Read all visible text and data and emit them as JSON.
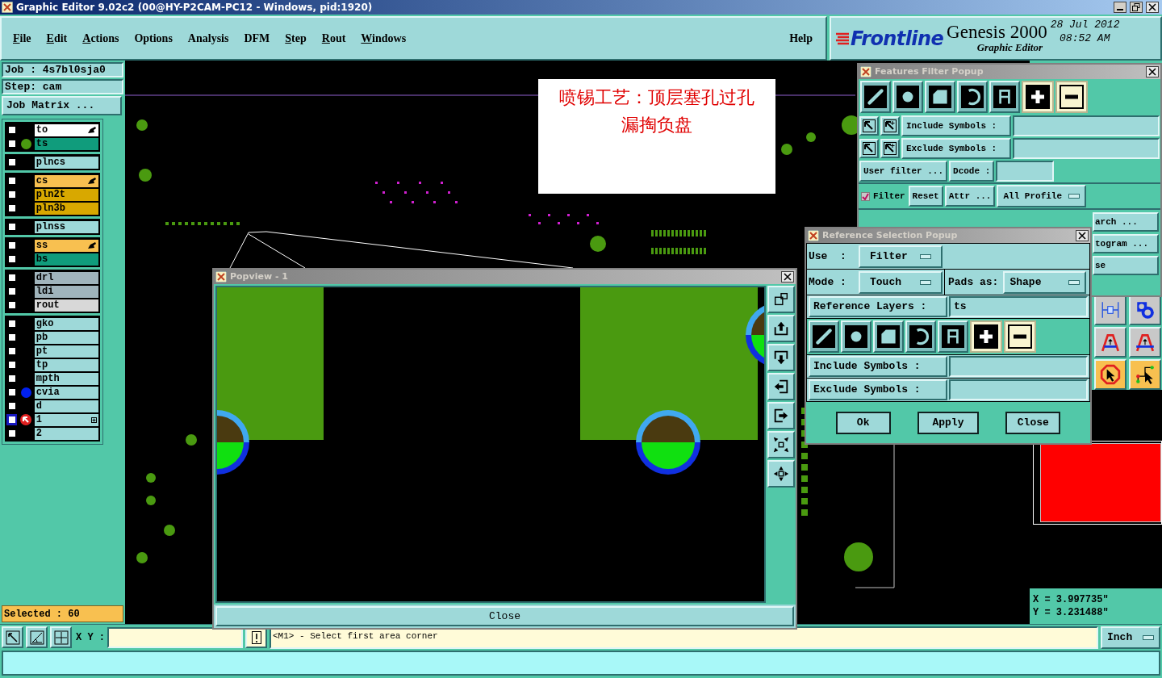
{
  "window": {
    "title": "Graphic Editor 9.02c2 (00@HY-P2CAM-PC12 - Windows, pid:1920)"
  },
  "menu": [
    {
      "label": "File",
      "mnemonic": true
    },
    {
      "label": "Edit",
      "mnemonic": true
    },
    {
      "label": "Actions",
      "mnemonic": true
    },
    {
      "label": "Options",
      "mnemonic": false
    },
    {
      "label": "Analysis",
      "mnemonic": false
    },
    {
      "label": "DFM",
      "mnemonic": false
    },
    {
      "label": "Step",
      "mnemonic": true
    },
    {
      "label": "Rout",
      "mnemonic": true
    },
    {
      "label": "Windows",
      "mnemonic": true
    }
  ],
  "help": "Help",
  "brand": {
    "logo": "Frontline",
    "product": "Genesis 2000",
    "subtitle": "Graphic Editor",
    "date": "28 Jul 2012",
    "time": "08:52 AM"
  },
  "job": {
    "job": "Job : 4s7bl0sja0",
    "step": "Step: cam",
    "matrix_button": "Job Matrix ..."
  },
  "layer_groups": [
    [
      {
        "name": "to",
        "color": "#ffffff",
        "checked": false,
        "selected": false,
        "hand_mark": true,
        "expand_mark": false
      },
      {
        "name": "ts",
        "color": "#109c7c",
        "checked": false,
        "selected": false,
        "hand_mark": false,
        "expand_mark": false,
        "indicator": {
          "kind": "dot",
          "color": "#4a9a10"
        }
      }
    ],
    [
      {
        "name": "plncs",
        "color": "#9ed9d9",
        "checked": false,
        "selected": false,
        "hand_mark": false,
        "expand_mark": false
      }
    ],
    [
      {
        "name": "cs",
        "color": "#f8c050",
        "checked": false,
        "selected": false,
        "hand_mark": true,
        "expand_mark": false
      },
      {
        "name": "pln2t",
        "color": "#d8a800",
        "checked": false,
        "selected": false,
        "hand_mark": false,
        "expand_mark": false
      },
      {
        "name": "pln3b",
        "color": "#d8a800",
        "checked": false,
        "selected": false,
        "hand_mark": false,
        "expand_mark": false
      }
    ],
    [
      {
        "name": "plnss",
        "color": "#9ed9d9",
        "checked": false,
        "selected": false,
        "hand_mark": false,
        "expand_mark": false
      }
    ],
    [
      {
        "name": "ss",
        "color": "#f8c050",
        "checked": false,
        "selected": false,
        "hand_mark": true,
        "expand_mark": false
      },
      {
        "name": "bs",
        "color": "#109c7c",
        "checked": false,
        "selected": false,
        "hand_mark": false,
        "expand_mark": false
      }
    ],
    [
      {
        "name": "drl",
        "color": "#a0b4bc",
        "checked": false,
        "selected": false,
        "hand_mark": false,
        "expand_mark": false
      },
      {
        "name": "ldi",
        "color": "#a0b4bc",
        "checked": false,
        "selected": false,
        "hand_mark": false,
        "expand_mark": false
      },
      {
        "name": "rout",
        "color": "#d8d8d8",
        "checked": false,
        "selected": false,
        "hand_mark": false,
        "expand_mark": false
      }
    ],
    [
      {
        "name": "gko",
        "color": "#9ed9d9",
        "checked": false,
        "selected": false,
        "hand_mark": false,
        "expand_mark": false
      },
      {
        "name": "pb",
        "color": "#9ed9d9",
        "checked": false,
        "selected": false,
        "hand_mark": false,
        "expand_mark": false
      },
      {
        "name": "pt",
        "color": "#9ed9d9",
        "checked": false,
        "selected": false,
        "hand_mark": false,
        "expand_mark": false
      },
      {
        "name": "tp",
        "color": "#9ed9d9",
        "checked": false,
        "selected": false,
        "hand_mark": false,
        "expand_mark": false
      },
      {
        "name": "mpth",
        "color": "#9ed9d9",
        "checked": false,
        "selected": false,
        "hand_mark": false,
        "expand_mark": false
      },
      {
        "name": "cvia",
        "color": "#9ed9d9",
        "checked": false,
        "selected": false,
        "hand_mark": false,
        "expand_mark": false,
        "indicator": {
          "kind": "dot",
          "color": "#0020f0"
        }
      },
      {
        "name": "d",
        "color": "#9ed9d9",
        "checked": false,
        "selected": false,
        "hand_mark": false,
        "expand_mark": false
      },
      {
        "name": "1",
        "color": "#9ed9d9",
        "checked": false,
        "selected": true,
        "hand_mark": false,
        "expand_mark": true,
        "indicator": {
          "kind": "arrow"
        }
      },
      {
        "name": "2",
        "color": "#9ed9d9",
        "checked": false,
        "selected": false,
        "hand_mark": false,
        "expand_mark": false
      }
    ]
  ],
  "selected_count": "Selected : 60",
  "annotation": [
    "喷锡工艺：顶层塞孔过孔",
    "漏掏负盘"
  ],
  "popview": {
    "title": "Popview - 1",
    "close": "Close"
  },
  "features_filter": {
    "title": "Features Filter Popup",
    "polarity": [
      {
        "selected": true
      },
      {
        "selected": false
      }
    ],
    "include_label": "Include Symbols :",
    "exclude_label": "Exclude Symbols :",
    "user_filter": "User filter ...",
    "dcode_label": "Dcode :",
    "filter": {
      "label": "Filter",
      "checked": true
    },
    "reset": "Reset",
    "attr": "Attr ...",
    "profile": "All Profile",
    "partial_buttons": [
      "arch ...",
      "togram ...",
      "se"
    ]
  },
  "reference_popup": {
    "title": "Reference Selection Popup",
    "use_label": "Use  :",
    "use_value": "Filter",
    "mode_label": "Mode :",
    "mode_value": "Touch",
    "pads_label": "Pads as:",
    "pads_value": "Shape",
    "layers_label": "Reference Layers :",
    "layers_value": "ts",
    "polarity": [
      {
        "selected": true
      },
      {
        "selected": false
      }
    ],
    "include_label": "Include Symbols :",
    "exclude_label": "Exclude Symbols :",
    "buttons": [
      "Ok",
      "Apply",
      "Close"
    ]
  },
  "coordinates": [
    "X = 3.997735\"",
    "Y = 3.231488\""
  ],
  "status": {
    "xy_label": "X Y :",
    "message": "<M1> - Select first area corner",
    "units": "Inch"
  }
}
